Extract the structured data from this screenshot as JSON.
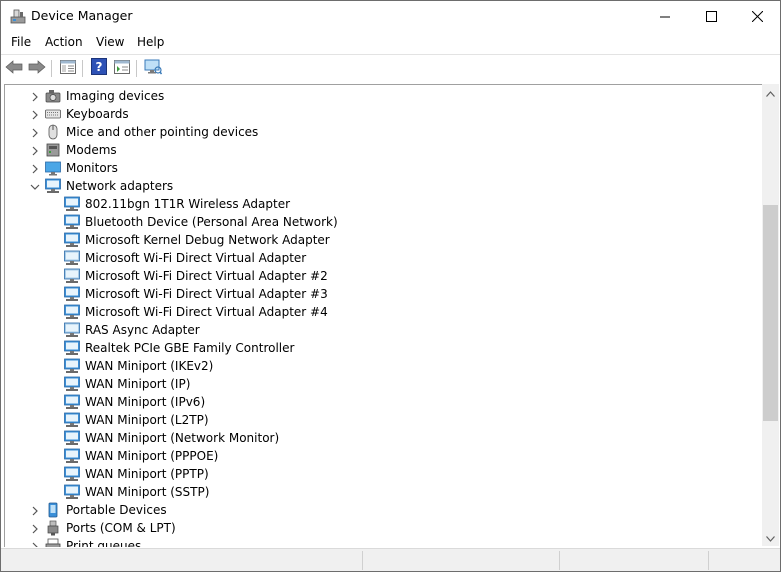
{
  "window": {
    "title": "Device Manager"
  },
  "menu": [
    "File",
    "Action",
    "View",
    "Help"
  ],
  "toolbar": {
    "buttons": [
      "back-arrow-icon",
      "forward-arrow-icon",
      "show-hide-console-tree-icon",
      "help-icon",
      "properties-icon",
      "scan-hardware-icon"
    ]
  },
  "tree": {
    "categories_above": [
      {
        "label": "Imaging devices",
        "icon": "camera-icon"
      },
      {
        "label": "Keyboards",
        "icon": "keyboard-icon"
      },
      {
        "label": "Mice and other pointing devices",
        "icon": "mouse-icon"
      },
      {
        "label": "Modems",
        "icon": "modem-icon"
      },
      {
        "label": "Monitors",
        "icon": "monitor-icon"
      }
    ],
    "expanded": {
      "label": "Network adapters",
      "icon": "network-adapter-icon"
    },
    "adapters": [
      {
        "label": "802.11bgn 1T1R Wireless Adapter",
        "dim": false
      },
      {
        "label": "Bluetooth Device (Personal Area Network)",
        "dim": false
      },
      {
        "label": "Microsoft Kernel Debug Network Adapter",
        "dim": false
      },
      {
        "label": "Microsoft Wi-Fi Direct Virtual Adapter",
        "dim": true
      },
      {
        "label": "Microsoft Wi-Fi Direct Virtual Adapter #2",
        "dim": true
      },
      {
        "label": "Microsoft Wi-Fi Direct Virtual Adapter #3",
        "dim": false
      },
      {
        "label": "Microsoft Wi-Fi Direct Virtual Adapter #4",
        "dim": false
      },
      {
        "label": "RAS Async Adapter",
        "dim": true
      },
      {
        "label": "Realtek PCIe GBE Family Controller",
        "dim": false
      },
      {
        "label": "WAN Miniport (IKEv2)",
        "dim": false
      },
      {
        "label": "WAN Miniport (IP)",
        "dim": false
      },
      {
        "label": "WAN Miniport (IPv6)",
        "dim": false
      },
      {
        "label": "WAN Miniport (L2TP)",
        "dim": false
      },
      {
        "label": "WAN Miniport (Network Monitor)",
        "dim": false
      },
      {
        "label": "WAN Miniport (PPPOE)",
        "dim": false
      },
      {
        "label": "WAN Miniport (PPTP)",
        "dim": false
      },
      {
        "label": "WAN Miniport (SSTP)",
        "dim": false
      }
    ],
    "categories_below": [
      {
        "label": "Portable Devices",
        "icon": "portable-device-icon"
      },
      {
        "label": "Ports (COM & LPT)",
        "icon": "port-icon"
      },
      {
        "label": "Print queues",
        "icon": "printer-icon"
      }
    ]
  },
  "colors": {
    "adapter": "#3a8fd8",
    "adapter_dim": "#a9cde9",
    "chevron": "#555555"
  }
}
